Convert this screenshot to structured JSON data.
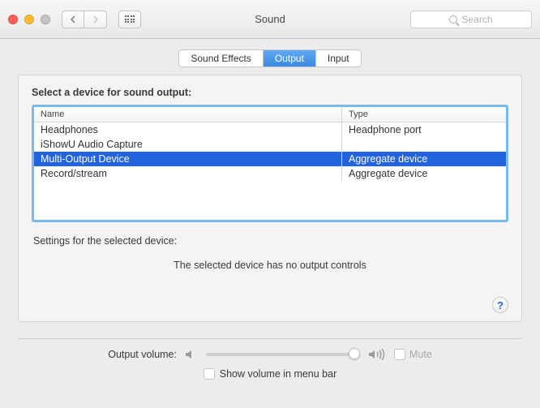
{
  "window": {
    "title": "Sound",
    "search_placeholder": "Search"
  },
  "tabs": [
    {
      "label": "Sound Effects",
      "active": false
    },
    {
      "label": "Output",
      "active": true
    },
    {
      "label": "Input",
      "active": false
    }
  ],
  "panel": {
    "heading": "Select a device for sound output:",
    "columns": {
      "name": "Name",
      "type": "Type"
    },
    "devices": [
      {
        "name": "Headphones",
        "type": "Headphone port",
        "selected": false
      },
      {
        "name": "iShowU Audio Capture",
        "type": "",
        "selected": false
      },
      {
        "name": "Multi-Output Device",
        "type": "Aggregate device",
        "selected": true
      },
      {
        "name": "Record/stream",
        "type": "Aggregate device",
        "selected": false
      }
    ],
    "settings_label": "Settings for the selected device:",
    "no_controls": "The selected device has no output controls",
    "help_label": "?"
  },
  "footer": {
    "volume_label": "Output volume:",
    "mute_label": "Mute",
    "show_in_menubar": "Show volume in menu bar"
  }
}
